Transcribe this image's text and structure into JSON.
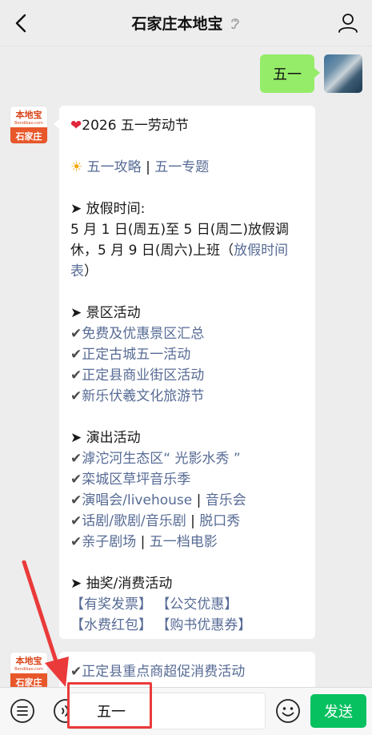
{
  "header": {
    "title": "石家庄本地宝"
  },
  "user_message": {
    "text": "五一"
  },
  "bot": {
    "avatar_top": "本地宝",
    "avatar_url_text": "Bendibao.com",
    "avatar_bottom": "石家庄",
    "title": "2026 五一劳动节",
    "guide_link": "五一攻略",
    "topic_link": "五一专题",
    "holiday_heading": "➤ 放假时间:",
    "holiday_text_1": "5 月 1 日(周五)至 5 日(周二)放假调休，5 月 9 日(周六)上班（",
    "holiday_link": "放假时间表",
    "holiday_text_2": "）",
    "scenic_heading": "➤ 景区活动",
    "scenic_items": [
      "免费及优惠景区汇总",
      "正定古城五一活动",
      "正定县商业街区活动",
      "新乐伏羲文化旅游节"
    ],
    "show_heading": "➤ 演出活动",
    "show_item_1": "滹沱河生态区“ 光影水秀 ”",
    "show_item_2": "栾城区草坪音乐季",
    "show_item_3a": "演唱会/livehouse",
    "show_item_3b": "音乐会",
    "show_item_4a": "话剧/歌剧/音乐剧",
    "show_item_4b": "脱口秀",
    "show_item_5a": "亲子剧场",
    "show_item_5b": "五一档电影",
    "lottery_heading": "➤ 抽奖/消费活动",
    "lottery_1": "【有奖发票】",
    "lottery_2": "【公交优惠】",
    "lottery_3": "【水费红包】",
    "lottery_4": "【购书优惠券】",
    "second_message": "正定县重点商超促消费活动"
  },
  "input": {
    "value": "五一"
  },
  "toolbar": {
    "send_label": "发送"
  },
  "colors": {
    "accent": "#07c160",
    "self_bubble": "#95ec69",
    "link": "#576b95",
    "annotation": "#ea3a3a"
  }
}
